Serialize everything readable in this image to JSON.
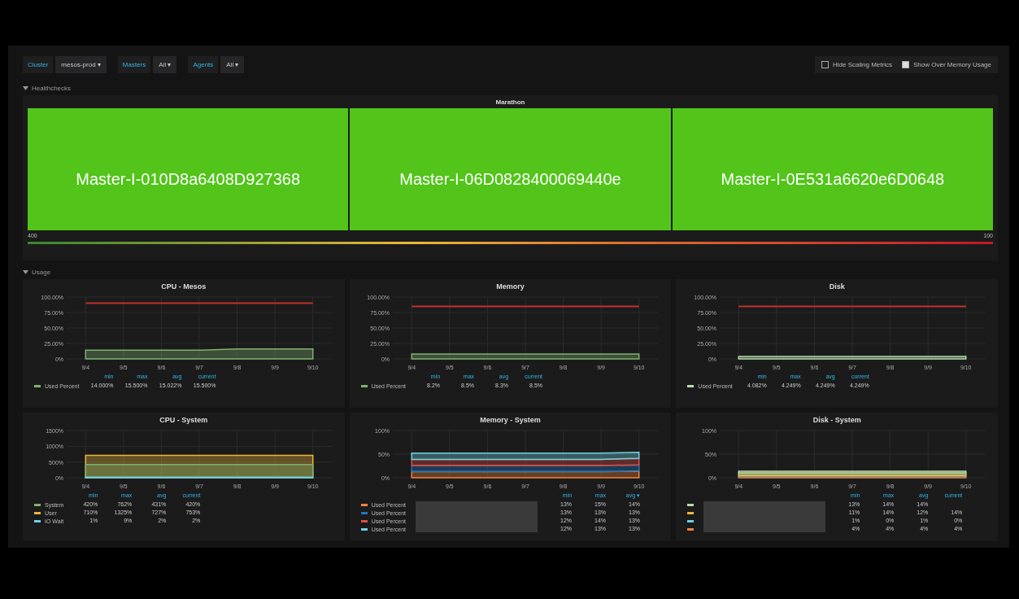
{
  "toolbar": {
    "variables": [
      {
        "label": "Cluster",
        "value": "mesos-prod ▾"
      },
      {
        "label": "Masters",
        "value": "All ▾"
      },
      {
        "label": "Agents",
        "value": "All ▾"
      }
    ],
    "toggles": [
      {
        "label": "Hide Scaling Metrics",
        "checked": false
      },
      {
        "label": "Show Over Memory Usage",
        "checked": true
      }
    ]
  },
  "healthchecks": {
    "title": "Healthchecks",
    "panel_title": "Marathon",
    "cells": [
      {
        "name": "Master-I-010D8a6408D927368",
        "color": "#52c41a"
      },
      {
        "name": "Master-I-06D0828400069440e",
        "color": "#52c41a"
      },
      {
        "name": "Master-I-0E531a6620e6D0648",
        "color": "#52c41a"
      }
    ],
    "scale_min": "400",
    "scale_max": "100"
  },
  "usage": {
    "title": "Usage",
    "panels": [
      {
        "title": "CPU - Mesos",
        "chart_data": {
          "type": "area",
          "grid": true,
          "x": [
            "9/4",
            "9/5",
            "9/6",
            "9/7",
            "9/8",
            "9/9",
            "9/10"
          ],
          "ylim": [
            0,
            100
          ],
          "yticks": [
            {
              "value": 0,
              "label": "0%"
            },
            {
              "value": 25,
              "label": "25.00%"
            },
            {
              "value": 50,
              "label": "50.00%"
            },
            {
              "value": 75,
              "label": "75.00%"
            },
            {
              "value": 100,
              "label": "100.00%"
            }
          ],
          "series": [
            {
              "color": "#7eb26d",
              "values": [
                14,
                14,
                14,
                14,
                16,
                16,
                16
              ]
            },
            {
              "type": "line",
              "color": "#c4302b",
              "values": [
                90,
                90,
                90,
                90,
                90,
                90,
                90
              ]
            }
          ]
        },
        "legend": {
          "columns": [
            "min",
            "max",
            "avg",
            "current"
          ],
          "rows": [
            {
              "name": "Used Percent",
              "color": "#7eb26d",
              "min": "14.000%",
              "max": "15.500%",
              "avg": "15.022%",
              "current": "15.500%"
            }
          ]
        }
      },
      {
        "title": "Memory",
        "chart_data": {
          "type": "area",
          "grid": true,
          "x": [
            "9/4",
            "9/5",
            "9/6",
            "9/7",
            "9/8",
            "9/9",
            "9/10"
          ],
          "ylim": [
            0,
            100
          ],
          "yticks": [
            {
              "value": 0,
              "label": "0%"
            },
            {
              "value": 25,
              "label": "25.00%"
            },
            {
              "value": 50,
              "label": "50.00%"
            },
            {
              "value": 75,
              "label": "75.00%"
            },
            {
              "value": 100,
              "label": "100.00%"
            }
          ],
          "series": [
            {
              "color": "#7eb26d",
              "values": [
                8,
                8,
                8,
                8,
                8,
                8,
                8
              ]
            },
            {
              "type": "line",
              "color": "#c4302b",
              "values": [
                85,
                85,
                85,
                85,
                85,
                85,
                85
              ]
            }
          ]
        },
        "legend": {
          "columns": [
            "min",
            "max",
            "avg",
            "current"
          ],
          "rows": [
            {
              "name": "Used Percent",
              "color": "#7eb26d",
              "min": "8.2%",
              "max": "8.5%",
              "avg": "8.3%",
              "current": "8.5%"
            }
          ]
        }
      },
      {
        "title": "Disk",
        "chart_data": {
          "type": "area",
          "grid": true,
          "x": [
            "9/4",
            "9/5",
            "9/6",
            "9/7",
            "9/8",
            "9/9",
            "9/10"
          ],
          "ylim": [
            0,
            100
          ],
          "yticks": [
            {
              "value": 0,
              "label": "0%"
            },
            {
              "value": 25,
              "label": "25.00%"
            },
            {
              "value": 50,
              "label": "50.00%"
            },
            {
              "value": 75,
              "label": "75.00%"
            },
            {
              "value": 100,
              "label": "100.00%"
            }
          ],
          "series": [
            {
              "color": "#b7dbab",
              "values": [
                4,
                4,
                4,
                4,
                4,
                4,
                4
              ]
            },
            {
              "type": "line",
              "color": "#c4302b",
              "values": [
                85,
                85,
                85,
                85,
                85,
                85,
                85
              ]
            }
          ]
        },
        "legend": {
          "columns": [
            "min",
            "max",
            "avg",
            "current"
          ],
          "rows": [
            {
              "name": "Used Percent",
              "color": "#b7dbab",
              "min": "4.082%",
              "max": "4.249%",
              "avg": "4.249%",
              "current": "4.249%"
            }
          ]
        }
      },
      {
        "title": "CPU - System",
        "chart_data": {
          "type": "area",
          "grid": true,
          "x": [
            "9/4",
            "9/5",
            "9/6",
            "9/7",
            "9/8",
            "9/9",
            "9/10"
          ],
          "ylim": [
            0,
            1500
          ],
          "yticks": [
            {
              "value": 0,
              "label": "0%"
            },
            {
              "value": 500,
              "label": "500%"
            },
            {
              "value": 1000,
              "label": "1000%"
            },
            {
              "value": 1500,
              "label": "1500%"
            }
          ],
          "series": [
            {
              "color": "#eab839",
              "values": [
                710,
                710,
                710,
                710,
                710,
                710,
                710
              ]
            },
            {
              "color": "#7eb26d",
              "values": [
                420,
                420,
                420,
                420,
                420,
                420,
                420
              ]
            },
            {
              "color": "#6ed0e0",
              "values": [
                20,
                20,
                20,
                20,
                20,
                20,
                20
              ]
            }
          ]
        },
        "legend": {
          "columns": [
            "min",
            "max",
            "avg",
            "current"
          ],
          "rows": [
            {
              "name": "System",
              "color": "#7eb26d",
              "min": "420%",
              "max": "762%",
              "avg": "431%",
              "current": "420%"
            },
            {
              "name": "User",
              "color": "#eab839",
              "min": "710%",
              "max": "1325%",
              "avg": "727%",
              "current": "753%"
            },
            {
              "name": "IO Wait",
              "color": "#6ed0e0",
              "min": "1%",
              "max": "9%",
              "avg": "2%",
              "current": "2%"
            }
          ]
        }
      },
      {
        "title": "Memory - System",
        "chart_data": {
          "type": "area",
          "grid": true,
          "stacked": true,
          "x": [
            "9/4",
            "9/5",
            "9/6",
            "9/7",
            "9/8",
            "9/9",
            "9/10"
          ],
          "ylim": [
            0,
            100
          ],
          "yticks": [
            {
              "value": 0,
              "label": "0%"
            },
            {
              "value": 50,
              "label": "50%"
            },
            {
              "value": 100,
              "label": "100%"
            }
          ],
          "series": [
            {
              "color": "#ef843c",
              "values": [
                13,
                13,
                13,
                13,
                13,
                13,
                14
              ]
            },
            {
              "color": "#1f78c1",
              "values": [
                13,
                13,
                13,
                13,
                13,
                13,
                13
              ]
            },
            {
              "color": "#e24d42",
              "values": [
                13,
                13,
                13,
                13,
                13,
                13,
                14
              ]
            },
            {
              "color": "#6ed0e0",
              "values": [
                13,
                13,
                13,
                13,
                13,
                13,
                13
              ]
            }
          ]
        },
        "legend": {
          "columns": [
            "min",
            "max",
            "avg ▾"
          ],
          "redacted": true,
          "rows": [
            {
              "name": "Used Percent",
              "color": "#ef843c",
              "min": "13%",
              "max": "15%",
              "avg": "14%"
            },
            {
              "name": "Used Percent",
              "color": "#1f78c1",
              "min": "13%",
              "max": "13%",
              "avg": "13%"
            },
            {
              "name": "Used Percent",
              "color": "#e24d42",
              "min": "12%",
              "max": "14%",
              "avg": "13%"
            },
            {
              "name": "Used Percent",
              "color": "#6ed0e0",
              "min": "12%",
              "max": "13%",
              "avg": "13%"
            }
          ]
        }
      },
      {
        "title": "Disk - System",
        "chart_data": {
          "type": "area",
          "grid": true,
          "stacked": true,
          "x": [
            "9/4",
            "9/5",
            "9/6",
            "9/7",
            "9/8",
            "9/9",
            "9/10"
          ],
          "ylim": [
            0,
            100
          ],
          "yticks": [
            {
              "value": 0,
              "label": "0%"
            },
            {
              "value": 50,
              "label": "50%"
            },
            {
              "value": 100,
              "label": "100%"
            }
          ],
          "series": [
            {
              "color": "#ef843c",
              "values": [
                4,
                4,
                4,
                4,
                4,
                4,
                4
              ]
            },
            {
              "color": "#6ed0e0",
              "values": [
                2,
                2,
                2,
                2,
                2,
                2,
                2
              ]
            },
            {
              "color": "#eab839",
              "values": [
                4,
                4,
                4,
                4,
                4,
                4,
                4
              ]
            },
            {
              "color": "#b7dbab",
              "values": [
                4,
                4,
                4,
                4,
                4,
                4,
                4
              ]
            }
          ]
        },
        "legend": {
          "columns": [
            "min",
            "max",
            "avg",
            "current"
          ],
          "redacted": true,
          "rows": [
            {
              "color": "#b7dbab",
              "min": "13%",
              "max": "14%",
              "avg": "14%"
            },
            {
              "color": "#eab839",
              "min": "11%",
              "max": "14%",
              "avg": "12%",
              "current": "14%"
            },
            {
              "color": "#6ed0e0",
              "min": "1%",
              "max": "0%",
              "avg": "1%",
              "current": "0%"
            },
            {
              "color": "#ef843c",
              "min": "4%",
              "max": "4%",
              "avg": "4%",
              "current": "4%"
            }
          ]
        }
      }
    ]
  }
}
